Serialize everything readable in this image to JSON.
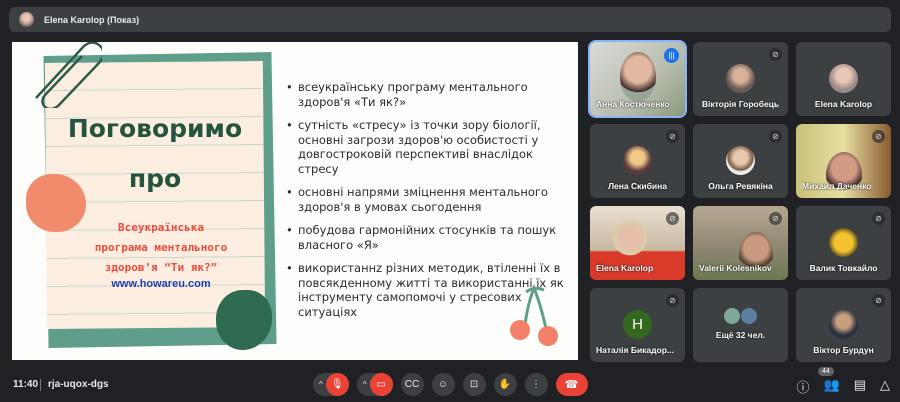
{
  "header": {
    "title": "Elena Karolop (Показ)"
  },
  "slide": {
    "title_line1": "Поговоримо",
    "title_line2": "про",
    "subtitle_lines": [
      "Всеукраїнська",
      "програма ментального",
      "здоров’я “Ти як?”"
    ],
    "url": "www.howareu.com",
    "bullets": [
      "всеукраїнську програму ментального здоров'я «Ти як?»",
      "сутність «стресу» із точки зору біології, основні загрози здоров'ю особистості у довгостроковій перспективі внаслідок стресу",
      "основні напрями зміцнення ментального здоров'я в умовах сьогодення",
      "побудова гармонійних стосунків та пошук власного «Я»",
      "використаннz різних методик, втіленні їх в повсякденному житті та використанні їх як інструменту самопомочі у стресових ситуаціях"
    ]
  },
  "participants": [
    {
      "name": "Анна Костюченко",
      "type": "video",
      "speaking": true
    },
    {
      "name": "Вікторія Горобець",
      "type": "avatar",
      "muted": true
    },
    {
      "name": "Elena Karolop",
      "type": "avatar",
      "muted": false
    },
    {
      "name": "Лена Скибина",
      "type": "avatar",
      "muted": true
    },
    {
      "name": "Ольга Ревякіна",
      "type": "avatar",
      "muted": true
    },
    {
      "name": "Михаил Даченко",
      "type": "video",
      "muted": true
    },
    {
      "name": "Elena Karolop",
      "type": "video",
      "muted": true
    },
    {
      "name": "Valerii Kolesnikov",
      "type": "video",
      "muted": true
    },
    {
      "name": "Валик Товкайло",
      "type": "avatar",
      "muted": true
    },
    {
      "name": "Наталія Бикадор...",
      "type": "letter",
      "letter": "H",
      "muted": true
    },
    {
      "name": "Ещё 32 чел.",
      "type": "more"
    },
    {
      "name": "Віктор Бурдун",
      "type": "avatar",
      "muted": true
    }
  ],
  "bottom": {
    "time": "11:40",
    "meeting_code": "rja-uqox-dgs",
    "participant_count": "44"
  },
  "colors": {
    "accent": "#1a73e8",
    "danger": "#ea4335",
    "green": "#5f9e8a"
  }
}
